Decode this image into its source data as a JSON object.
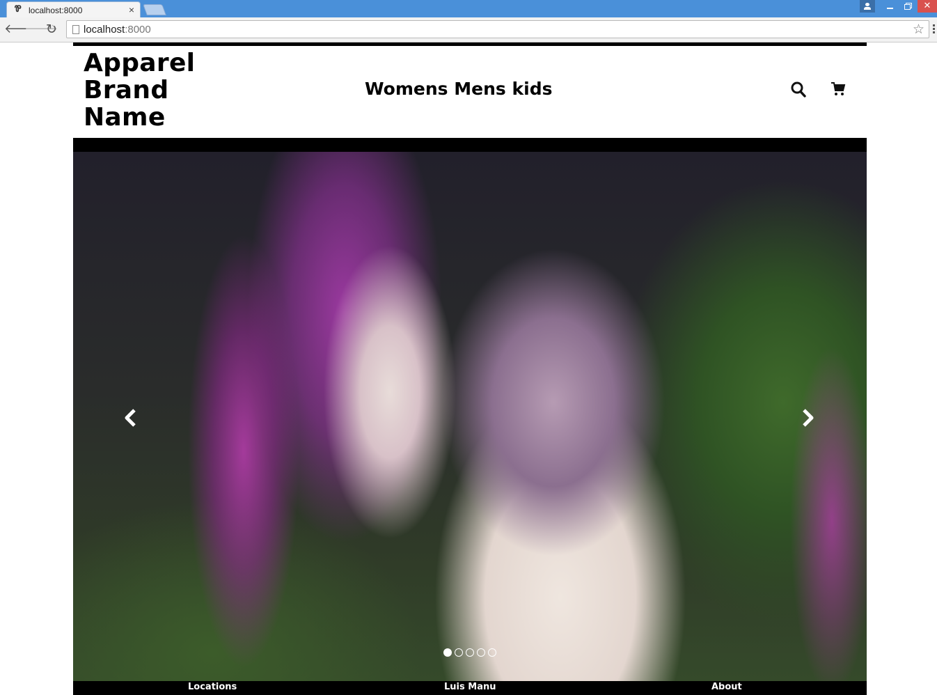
{
  "browser": {
    "tab_title": "localhost:8000",
    "tab_favicon": "Ꮘ",
    "tab_close": "×",
    "url_host": "localhost",
    "url_port": ":8000"
  },
  "brand": {
    "line1": "Apparel",
    "line2": "Brand",
    "line3": "Name"
  },
  "nav": {
    "items": [
      {
        "label": "Womens"
      },
      {
        "label": "Mens"
      },
      {
        "label": "kids"
      }
    ],
    "icons": [
      "search-icon",
      "cart-icon"
    ]
  },
  "carousel": {
    "slide_count": 5,
    "active_index": 0
  },
  "footer": {
    "links": [
      {
        "label": "Locations"
      },
      {
        "label": "Luis Manu"
      },
      {
        "label": "About"
      }
    ]
  }
}
